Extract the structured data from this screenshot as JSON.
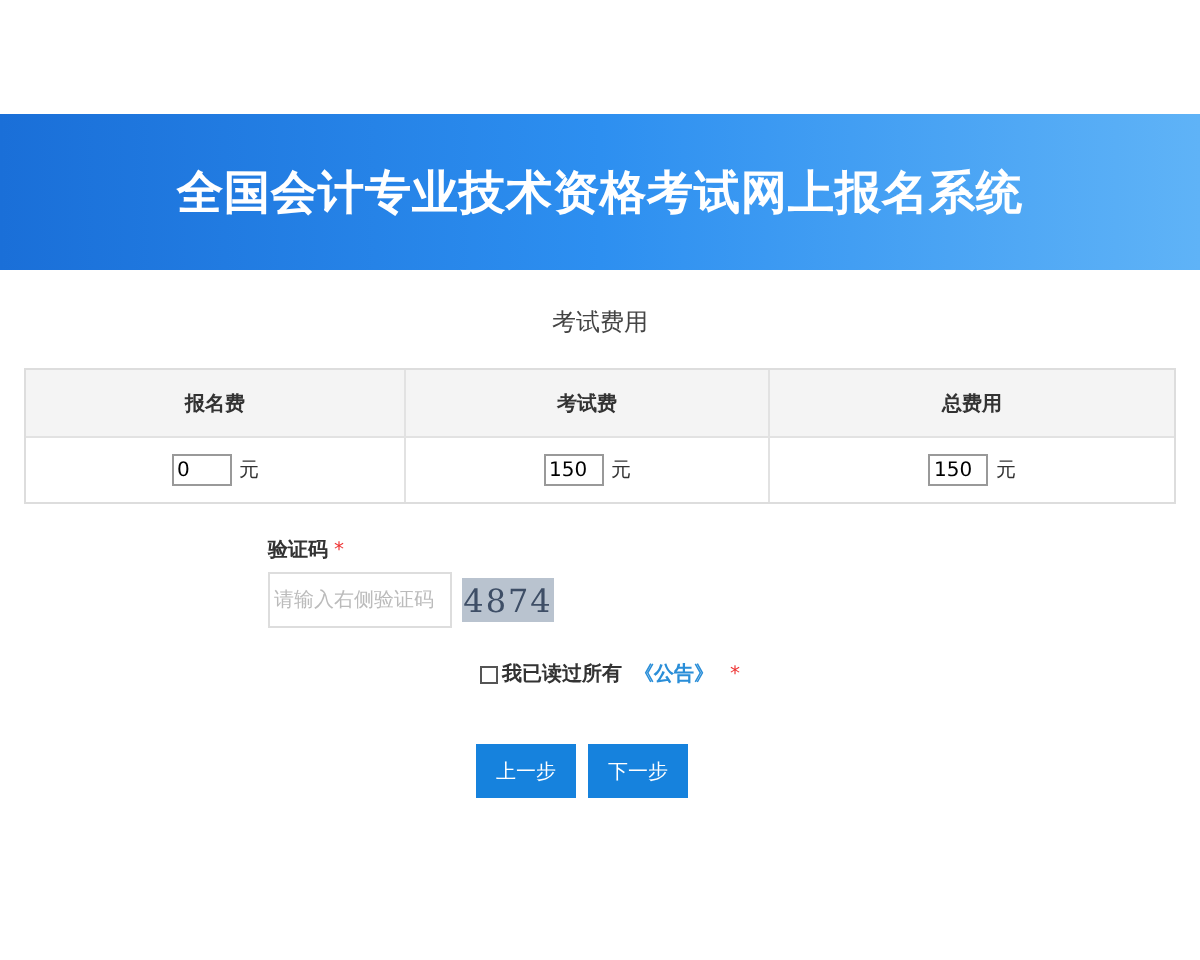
{
  "banner": {
    "title": "全国会计专业技术资格考试网上报名系统"
  },
  "fees": {
    "title": "考试费用",
    "columns": [
      "报名费",
      "考试费",
      "总费用"
    ],
    "values": [
      {
        "value": "0",
        "unit": "元"
      },
      {
        "value": "150",
        "unit": "元"
      },
      {
        "value": "150",
        "unit": "元"
      }
    ]
  },
  "captcha": {
    "label": "验证码",
    "required_mark": "*",
    "placeholder": "请输入右侧验证码",
    "code": "4874"
  },
  "agreement": {
    "checked": false,
    "text": "我已读过所有",
    "link": "《公告》",
    "required_mark": "*"
  },
  "buttons": [
    "上一步",
    "下一步"
  ]
}
